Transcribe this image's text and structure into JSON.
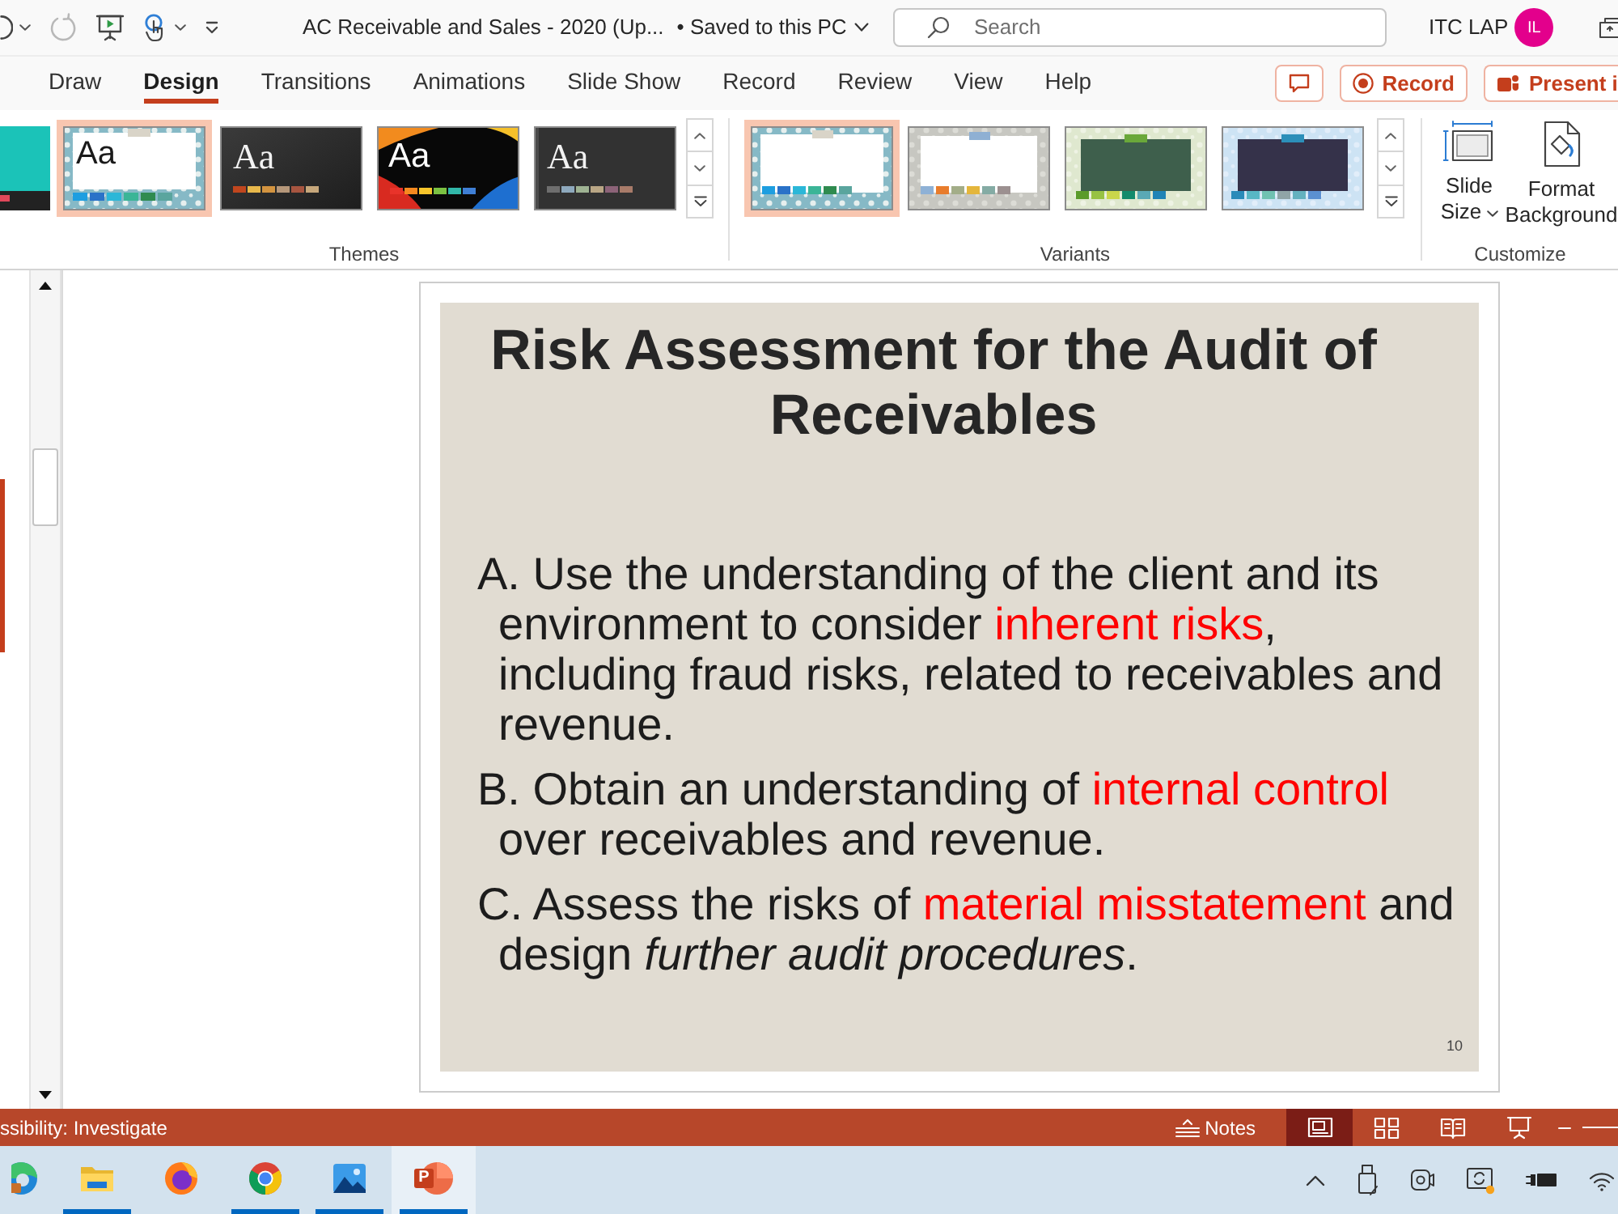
{
  "quick_access": [
    {
      "kind": "undo",
      "disabled": false,
      "menu": true
    },
    {
      "kind": "redo",
      "disabled": true,
      "menu": false
    },
    {
      "kind": "present",
      "disabled": false,
      "menu": false
    },
    {
      "kind": "touch",
      "disabled": false,
      "menu": true
    },
    {
      "kind": "customize",
      "disabled": false,
      "menu": false
    }
  ],
  "title_bar": {
    "document_title": "AC Receivable and Sales - 2020 (Up...",
    "save_status": "• Saved to this PC",
    "search": {
      "placeholder": "Search"
    },
    "account_name": "ITC LAP",
    "avatar_initials": "IL"
  },
  "tabs": [
    {
      "label": "Draw",
      "selected": false
    },
    {
      "label": "Design",
      "selected": true
    },
    {
      "label": "Transitions",
      "selected": false
    },
    {
      "label": "Animations",
      "selected": false
    },
    {
      "label": "Slide Show",
      "selected": false
    },
    {
      "label": "Record",
      "selected": false
    },
    {
      "label": "Review",
      "selected": false
    },
    {
      "label": "View",
      "selected": false
    },
    {
      "label": "Help",
      "selected": false
    }
  ],
  "tab_actions": [
    {
      "kind": "comments"
    },
    {
      "kind": "record",
      "label": "Record"
    },
    {
      "kind": "present",
      "label": "Present i"
    }
  ],
  "ribbon": {
    "themes": {
      "label": "Themes",
      "items": [
        {
          "kind": "teal",
          "selected": false
        },
        {
          "kind": "floral",
          "sample": "Aa",
          "selected": true
        },
        {
          "kind": "dark",
          "sample": "Aa",
          "selected": false
        },
        {
          "kind": "vivid",
          "sample": "Aa",
          "selected": false
        },
        {
          "kind": "slate",
          "sample": "Aa",
          "selected": false
        }
      ]
    },
    "variants": {
      "label": "Variants",
      "items": [
        {
          "kind": "floral",
          "selected": true
        },
        {
          "kind": "gray",
          "selected": false
        },
        {
          "kind": "green",
          "selected": false
        },
        {
          "kind": "navy",
          "selected": false
        }
      ]
    },
    "customize": {
      "label": "Customize",
      "buttons": [
        {
          "kind": "slide_size",
          "label": "Slide Size",
          "menu": true
        },
        {
          "kind": "format_background",
          "label": "Format Background",
          "menu": false
        }
      ]
    }
  },
  "slide": {
    "title": "Risk Assessment for the Audit of Receivables",
    "points": [
      {
        "segments": [
          {
            "text": "A. Use the understanding of the client and its environment to consider ",
            "highlighted": false
          },
          {
            "text": "inherent risks",
            "highlighted": true
          },
          {
            "text": ", including fraud risks, related to receivables and revenue.",
            "highlighted": false
          }
        ]
      },
      {
        "segments": [
          {
            "text": "B. Obtain an understanding of ",
            "highlighted": false
          },
          {
            "text": "internal control",
            "highlighted": true
          },
          {
            "text": " over receivables and revenue.",
            "highlighted": false
          }
        ]
      },
      {
        "segments": [
          {
            "text": "C. Assess the risks of ",
            "highlighted": false
          },
          {
            "text": "material misstatement",
            "highlighted": true
          },
          {
            "text": " and design *further audit procedures*.",
            "highlighted": false
          }
        ]
      }
    ],
    "slide_number": "10"
  },
  "status_bar": {
    "accessibility": "ssibility: Investigate",
    "notes": "Notes",
    "views": [
      {
        "kind": "normal",
        "selected": true
      },
      {
        "kind": "sorter",
        "selected": false
      },
      {
        "kind": "reading",
        "selected": false
      },
      {
        "kind": "slideshow",
        "selected": false
      }
    ]
  },
  "taskbar": {
    "apps": [
      {
        "kind": "edge",
        "running": false,
        "selected": false
      },
      {
        "kind": "explorer",
        "running": true,
        "selected": false
      },
      {
        "kind": "firefox",
        "running": false,
        "selected": false
      },
      {
        "kind": "chrome",
        "running": true,
        "selected": false
      },
      {
        "kind": "photos",
        "running": true,
        "selected": false
      },
      {
        "kind": "powerpoint",
        "glyph": "P",
        "running": true,
        "selected": true
      }
    ],
    "tray": [
      {
        "kind": "chevron"
      },
      {
        "kind": "usb"
      },
      {
        "kind": "camera"
      },
      {
        "kind": "display"
      },
      {
        "kind": "battery"
      },
      {
        "kind": "wifi"
      }
    ]
  }
}
